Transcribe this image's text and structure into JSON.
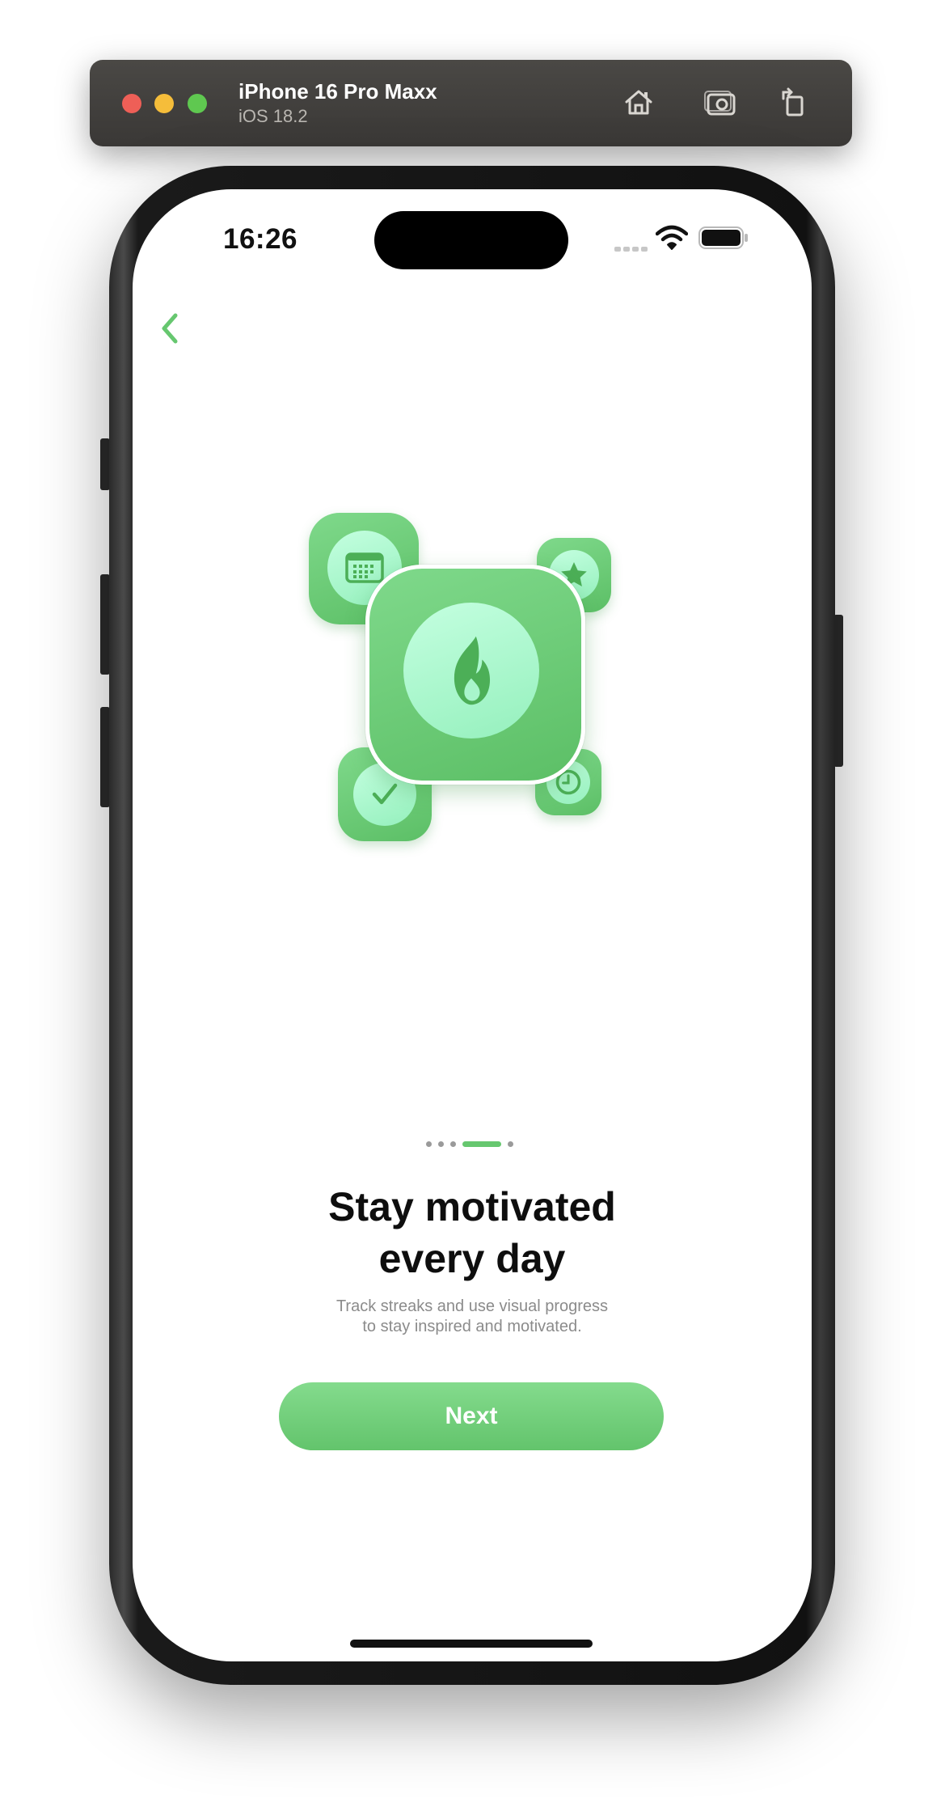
{
  "simulator": {
    "device_name": "iPhone 16 Pro Maxx",
    "os_version": "iOS 18.2",
    "toolbar_icons": [
      "home-icon",
      "screenshot-icon",
      "rotate-icon"
    ]
  },
  "status_bar": {
    "time": "16:26",
    "icons": [
      "cellular-signal-icon",
      "wifi-icon",
      "battery-icon"
    ]
  },
  "navigation": {
    "back_icon": "chevron-left-icon"
  },
  "illustration": {
    "main_icon": "flame-icon",
    "satellite_icons": [
      "calendar-icon",
      "star-icon",
      "checkmark-icon",
      "clock-icon"
    ]
  },
  "onboarding": {
    "page_count": 5,
    "current_page": 4,
    "title_line1": "Stay motivated",
    "title_line2": "every day",
    "subtitle_line1": "Track streaks and use visual progress",
    "subtitle_line2": "to stay inspired and motivated.",
    "next_label": "Next"
  },
  "colors": {
    "accent": "#66C76F",
    "accent_light": "#A8F5CB",
    "text_primary": "#0E0E0E",
    "text_secondary": "#8B8B8B"
  }
}
